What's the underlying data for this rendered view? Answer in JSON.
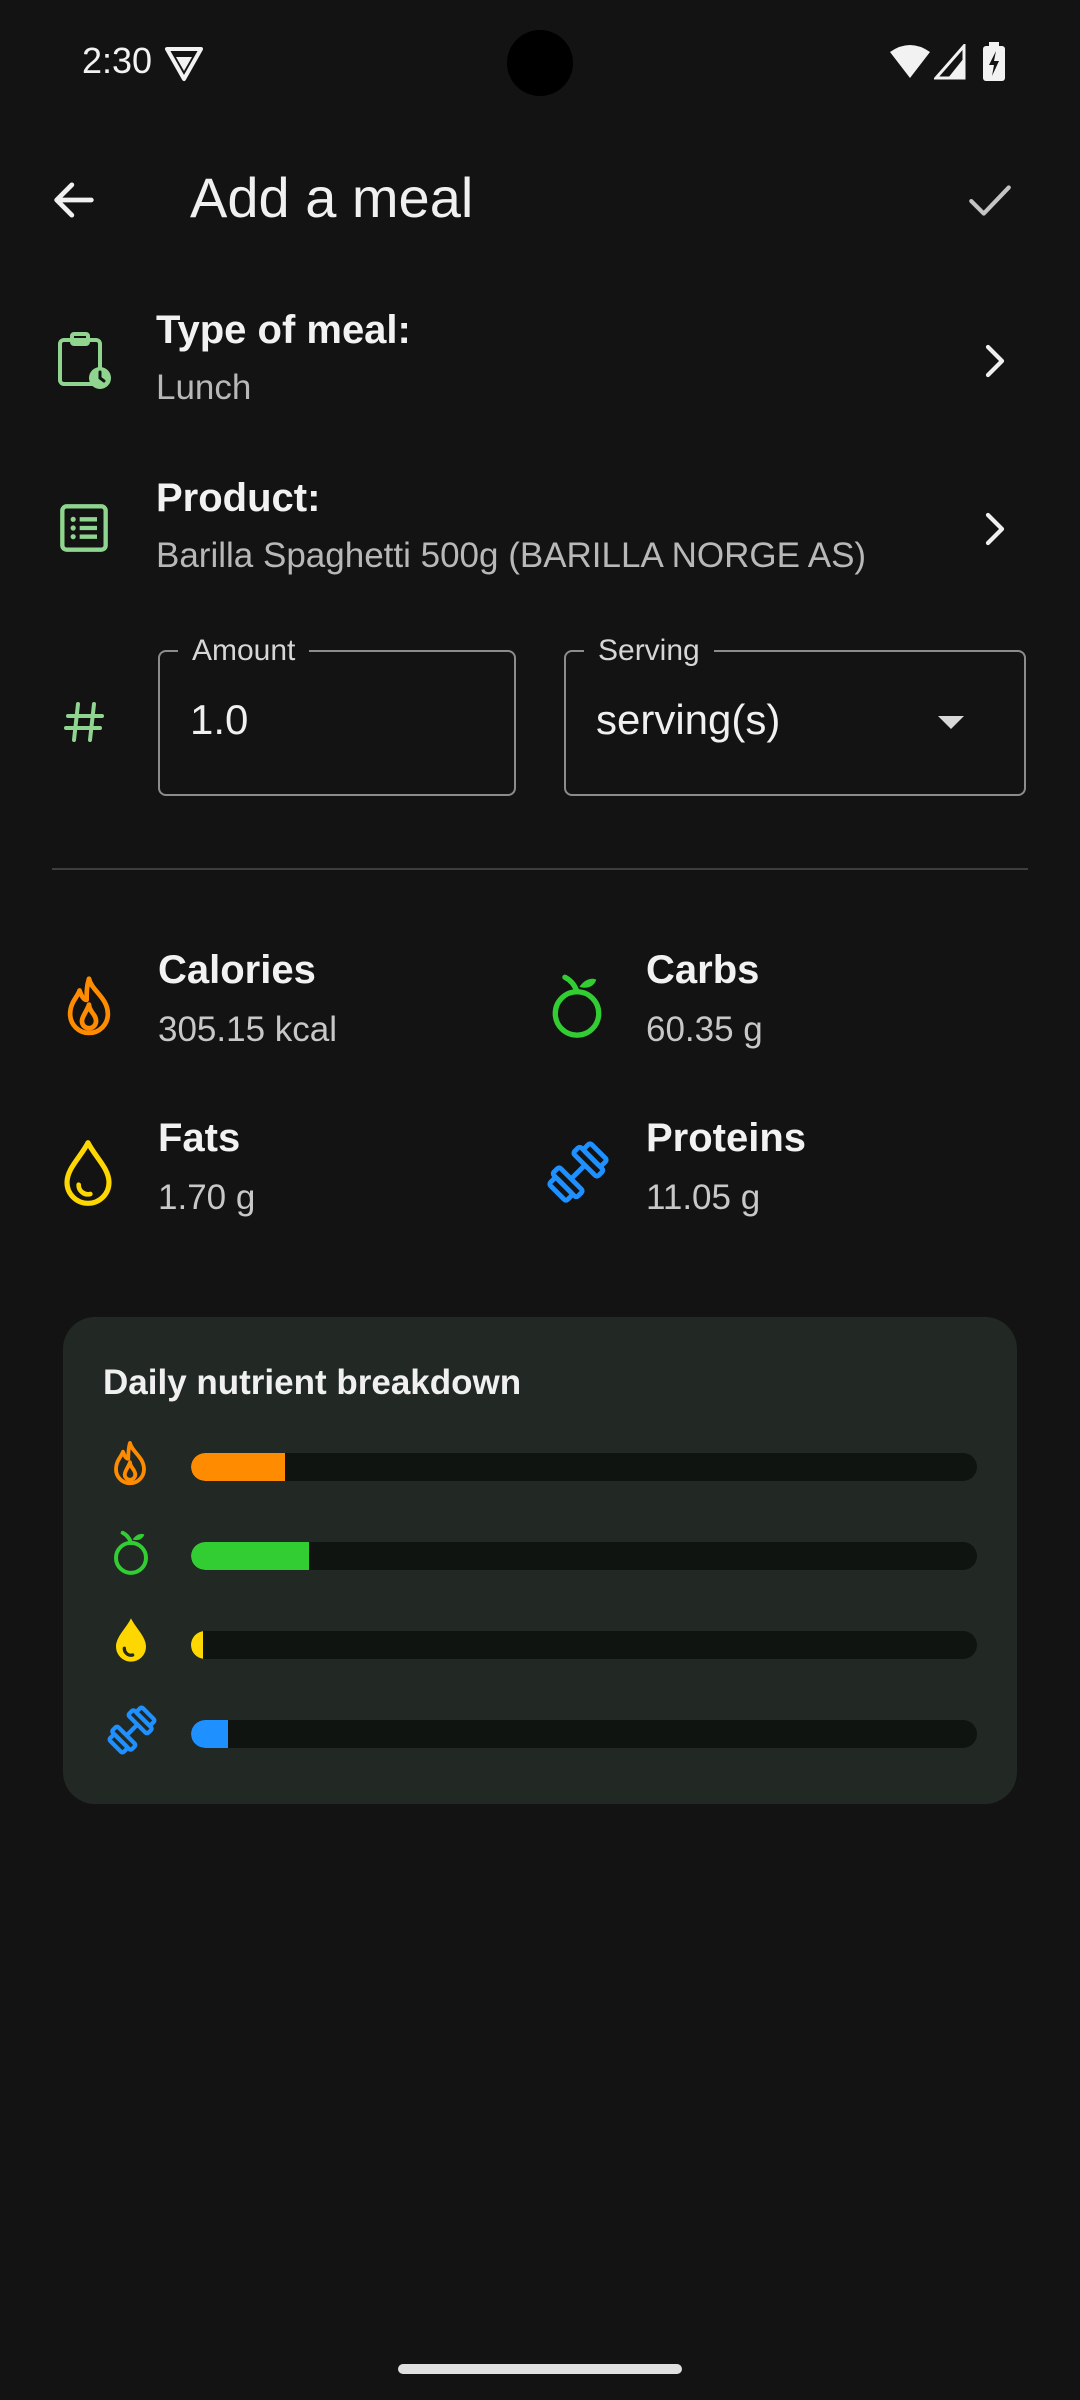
{
  "status_bar": {
    "time": "2:30"
  },
  "app_bar": {
    "title": "Add a meal"
  },
  "meal_type": {
    "label": "Type of meal:",
    "value": "Lunch"
  },
  "product": {
    "label": "Product:",
    "value": "Barilla Spaghetti 500g (BARILLA NORGE AS)"
  },
  "amount": {
    "label": "Amount",
    "value": "1.0"
  },
  "serving": {
    "label": "Serving",
    "value": "serving(s)"
  },
  "nutrients": {
    "calories": {
      "label": "Calories",
      "value": "305.15 kcal"
    },
    "carbs": {
      "label": "Carbs",
      "value": "60.35 g"
    },
    "fats": {
      "label": "Fats",
      "value": "1.70 g"
    },
    "proteins": {
      "label": "Proteins",
      "value": "11.05 g"
    }
  },
  "breakdown": {
    "title": "Daily nutrient breakdown",
    "bars": [
      {
        "name": "calories",
        "fraction": 0.12,
        "color": "#FF8C00"
      },
      {
        "name": "carbs",
        "fraction": 0.15,
        "color": "#32CD32"
      },
      {
        "name": "fats",
        "fraction": 0.015,
        "color": "#FFD700"
      },
      {
        "name": "proteins",
        "fraction": 0.047,
        "color": "#1E90FF"
      }
    ]
  },
  "colors": {
    "accent": "#8FD58F",
    "calories": "#FF8C00",
    "carbs": "#32CD32",
    "fats": "#FFD700",
    "proteins": "#1E90FF"
  },
  "icons": {
    "back": "arrow-left-icon",
    "confirm": "check-icon",
    "meal_type": "clipboard-clock-icon",
    "product": "list-icon",
    "amount": "hash-icon"
  }
}
